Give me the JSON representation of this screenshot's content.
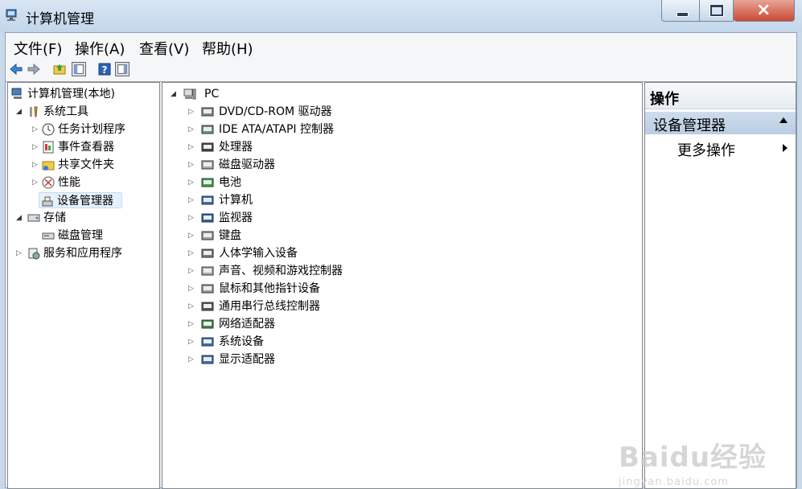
{
  "window": {
    "title": "计算机管理"
  },
  "menu": [
    "文件(F)",
    "操作(A)",
    "查看(V)",
    "帮助(H)"
  ],
  "left_tree": {
    "root": "计算机管理(本地)",
    "system_tools": "系统工具",
    "system_children": [
      "任务计划程序",
      "事件查看器",
      "共享文件夹",
      "性能",
      "设备管理器"
    ],
    "storage": "存储",
    "storage_children": [
      "磁盘管理"
    ],
    "services": "服务和应用程序"
  },
  "device_tree": {
    "root": "PC",
    "items": [
      "DVD/CD-ROM 驱动器",
      "IDE ATA/ATAPI 控制器",
      "处理器",
      "磁盘驱动器",
      "电池",
      "计算机",
      "监视器",
      "键盘",
      "人体学输入设备",
      "声音、视频和游戏控制器",
      "鼠标和其他指针设备",
      "通用串行总线控制器",
      "网络适配器",
      "系统设备",
      "显示适配器"
    ]
  },
  "actions": {
    "title": "操作",
    "section": "设备管理器",
    "item": "更多操作"
  },
  "watermark": {
    "brand": "Baidu经验",
    "url": "jingyan.baidu.com"
  }
}
